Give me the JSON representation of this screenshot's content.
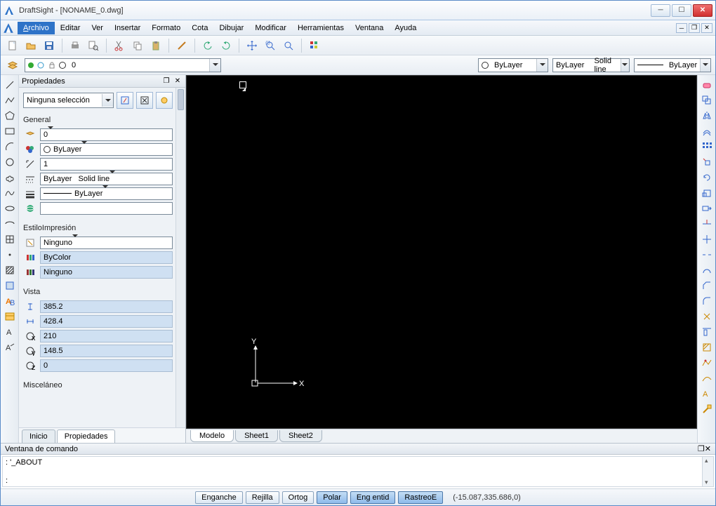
{
  "window": {
    "title": "DraftSight - [NONAME_0.dwg]"
  },
  "menu": {
    "items": [
      "Archivo",
      "Editar",
      "Ver",
      "Insertar",
      "Formato",
      "Cota",
      "Dibujar",
      "Modificar",
      "Herramientas",
      "Ventana",
      "Ayuda"
    ],
    "active_index": 0
  },
  "layerbar": {
    "layer_value": "0",
    "color_label": "ByLayer",
    "lineweight_label": "ByLayer",
    "linestyle_label": "Solid line",
    "linestyle2_label": "ByLayer"
  },
  "properties": {
    "title": "Propiedades",
    "selection": "Ninguna selección",
    "groups": {
      "general": {
        "title": "General",
        "layer": "0",
        "color": "ByLayer",
        "scale": "1",
        "linestyle_a": "ByLayer",
        "linestyle_b": "Solid line",
        "lineweight": "ByLayer",
        "hyperlink": ""
      },
      "print": {
        "title": "EstiloImpresión",
        "style": "Ninguno",
        "bycolor": "ByColor",
        "none": "Ninguno"
      },
      "view": {
        "title": "Vista",
        "v1": "385.2",
        "v2": "428.4",
        "v3": "210",
        "v4": "148.5",
        "v5": "0"
      },
      "misc": {
        "title": "Misceláneo"
      }
    },
    "tabs": {
      "home": "Inicio",
      "props": "Propiedades"
    }
  },
  "sheets": {
    "model": "Modelo",
    "s1": "Sheet1",
    "s2": "Sheet2"
  },
  "command": {
    "title": "Ventana de comando",
    "line1": ": '_ABOUT",
    "line2": ":"
  },
  "status": {
    "btns": [
      "Enganche",
      "Rejilla",
      "Ortog",
      "Polar",
      "Eng entid",
      "RastreoE"
    ],
    "active": [
      3,
      4,
      5
    ],
    "coords": "(-15.087,335.686,0)"
  },
  "ucs": {
    "x": "X",
    "y": "Y"
  }
}
